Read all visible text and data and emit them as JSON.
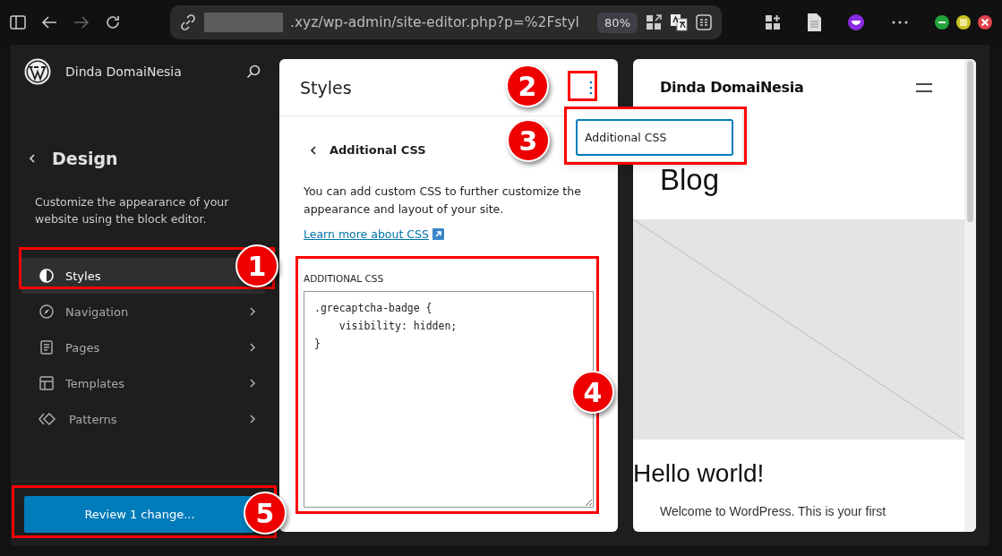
{
  "browser": {
    "url": ".xyz/wp-admin/site-editor.php?p=%2Fstyl",
    "zoom": "80%"
  },
  "sidebar": {
    "site_title": "Dinda DomaiNesia",
    "heading": "Design",
    "description": "Customize the appearance of your website using the block editor.",
    "items": [
      {
        "label": "Styles",
        "kind": "contrast",
        "selected": true
      },
      {
        "label": "Navigation",
        "kind": "compass",
        "selected": false
      },
      {
        "label": "Pages",
        "kind": "page",
        "selected": false
      },
      {
        "label": "Templates",
        "kind": "layout",
        "selected": false
      },
      {
        "label": "Patterns",
        "kind": "diamond",
        "selected": false
      }
    ],
    "save_button": "Review 1 change..."
  },
  "styles_panel": {
    "title": "Styles",
    "subheading": "Additional CSS",
    "description": "You can add custom CSS to further customize the appearance and layout of your site.",
    "link": "Learn more about CSS",
    "field_label": "ADDITIONAL CSS",
    "css_value": ".grecaptcha-badge {\n    visibility: hidden;\n}"
  },
  "menu": {
    "items": [
      {
        "label": "Additional CSS",
        "selected": true
      }
    ]
  },
  "preview": {
    "site_title": "Dinda DomaiNesia",
    "page_title": "Blog",
    "post_title": "Hello world!",
    "excerpt": "Welcome to WordPress. This is your first"
  },
  "annotations": [
    {
      "number": "1"
    },
    {
      "number": "2"
    },
    {
      "number": "3"
    },
    {
      "number": "4"
    },
    {
      "number": "5"
    }
  ]
}
